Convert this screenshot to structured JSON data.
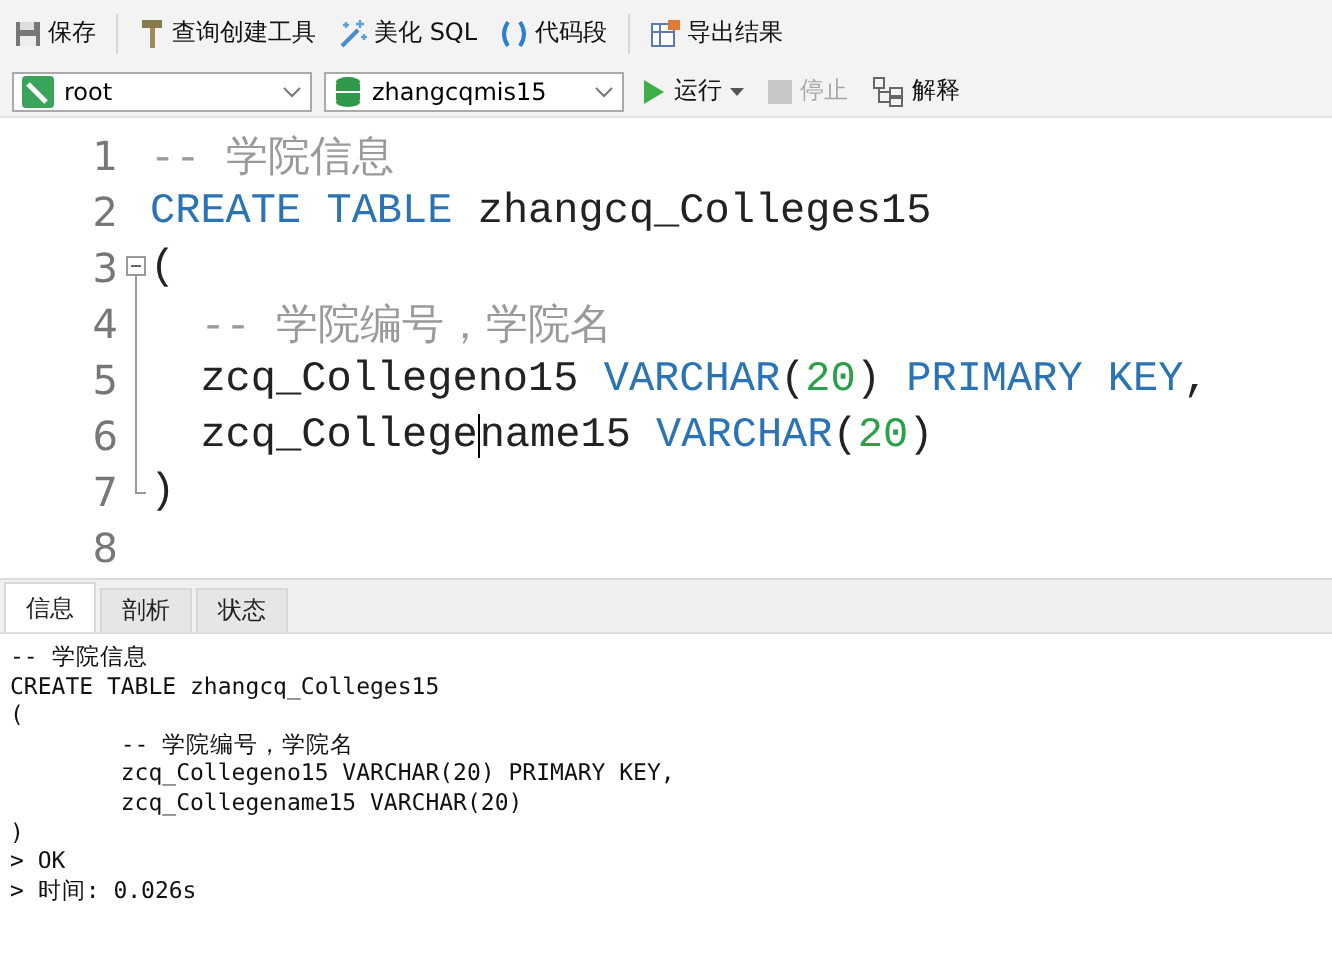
{
  "toolbar": [
    {
      "label": "保存"
    },
    {
      "label": "查询创建工具"
    },
    {
      "label": "美化 SQL"
    },
    {
      "label": "代码段"
    },
    {
      "label": "导出结果"
    }
  ],
  "connection": {
    "value": "root"
  },
  "database": {
    "value": "zhangcqmis15"
  },
  "actions": [
    {
      "label": "运行",
      "disabled": false
    },
    {
      "label": "停止",
      "disabled": true
    },
    {
      "label": "解释",
      "disabled": false
    }
  ],
  "editor": {
    "lines": [
      {
        "number": "1",
        "kind": "plain",
        "tokens": [
          {
            "text": "-- 学院信息",
            "kind": "comment"
          }
        ]
      },
      {
        "number": "2",
        "kind": "plain",
        "tokens": [
          {
            "text": "CREATE TABLE",
            "kind": "keyword"
          },
          {
            "text": " zhangcq_Colleges15",
            "kind": "ident"
          }
        ]
      },
      {
        "number": "3",
        "kind": "open",
        "tokens": [
          {
            "text": "(",
            "kind": "ident"
          }
        ]
      },
      {
        "number": "4",
        "kind": "inner",
        "tokens": [
          {
            "text": "  -- 学院编号，学院名",
            "kind": "comment"
          }
        ]
      },
      {
        "number": "5",
        "kind": "inner",
        "tokens": [
          {
            "text": "  zcq_Collegeno15 ",
            "kind": "ident"
          },
          {
            "text": "VARCHAR",
            "kind": "keyword"
          },
          {
            "text": "(",
            "kind": "ident"
          },
          {
            "text": "20",
            "kind": "number"
          },
          {
            "text": ") ",
            "kind": "ident"
          },
          {
            "text": "PRIMARY KEY",
            "kind": "keyword"
          },
          {
            "text": ",",
            "kind": "ident"
          }
        ]
      },
      {
        "number": "6",
        "kind": "inner",
        "tokens": [
          {
            "text": "  zcq_College",
            "kind": "ident"
          },
          {
            "kind": "caret"
          },
          {
            "text": "name15 ",
            "kind": "ident"
          },
          {
            "text": "VARCHAR",
            "kind": "keyword"
          },
          {
            "text": "(",
            "kind": "ident"
          },
          {
            "text": "20",
            "kind": "number"
          },
          {
            "text": ")",
            "kind": "ident"
          }
        ]
      },
      {
        "number": "7",
        "kind": "close",
        "tokens": [
          {
            "text": ")",
            "kind": "ident"
          }
        ]
      },
      {
        "number": "8",
        "kind": "plain"
      }
    ]
  },
  "result_tabs": [
    {
      "label": "信息",
      "selected": true
    },
    {
      "label": "剖析",
      "selected": false
    },
    {
      "label": "状态",
      "selected": false
    }
  ],
  "output": {
    "lines": [
      "-- 学院信息",
      "CREATE TABLE zhangcq_Colleges15",
      "(",
      "        -- 学院编号，学院名",
      "        zcq_Collegeno15 VARCHAR(20) PRIMARY KEY,",
      "        zcq_Collegename15 VARCHAR(20)",
      ")",
      "> OK",
      "> 时间: 0.026s"
    ]
  }
}
